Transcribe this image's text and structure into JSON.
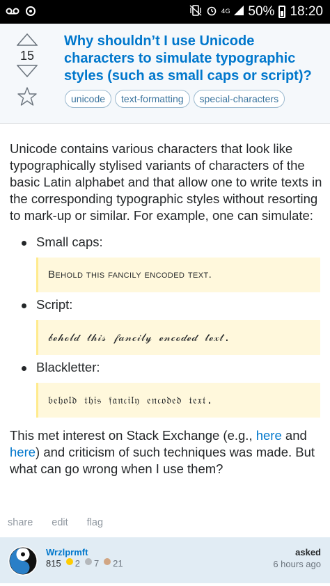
{
  "status_bar": {
    "network": "4G",
    "battery": "50%",
    "time": "18:20",
    "left_icons": [
      "voicemail-icon",
      "sync-icon"
    ],
    "right_icons": [
      "vibrate-icon",
      "alarm-icon",
      "signal-icon",
      "battery-icon"
    ]
  },
  "question": {
    "votes": "15",
    "title": "Why shouldn’t I use Unicode characters to simulate typographic styles (such as small caps or script)?",
    "tags": [
      "unicode",
      "text-formatting",
      "special-characters"
    ]
  },
  "body": {
    "intro": "Unicode contains various characters that look like typographically stylised variants of characters of the basic Latin alphabet and that allow one to write texts in the corresponding typographic styles without resorting to mark-up or similar. For example, one can simulate:",
    "examples": [
      {
        "label": "Small caps:",
        "quote": "Behold this fancily encoded text."
      },
      {
        "label": "Script:",
        "quote": "𝒷ℯ𝒽ℴ𝓁𝒹 𝓉𝒽𝒾𝓈 𝒻𝒶𝓃𝒸𝒾𝓁𝓎 ℯ𝓃𝒸ℴ𝒹ℯ𝒹 𝓉ℯ𝓍𝓉."
      },
      {
        "label": "Blackletter:",
        "quote": "𝔟𝔢𝔥𝔬𝔩𝔡 𝔱𝔥𝔦𝔰 𝔣𝔞𝔫𝔠𝔦𝔩𝔶 𝔢𝔫𝔠𝔬𝔡𝔢𝔡 𝔱𝔢𝔵𝔱."
      }
    ],
    "closing_part1": "This met interest on Stack Exchange (e.g., ",
    "link1": "here",
    "closing_part2": " and ",
    "link2": "here",
    "closing_part3": ") and criticism of such techniques was made. But what can go wrong when I use them?"
  },
  "actions": {
    "share": "share",
    "edit": "edit",
    "flag": "flag"
  },
  "user": {
    "name": "Wrzlprmft",
    "reputation": "815",
    "gold": "2",
    "silver": "7",
    "bronze": "21",
    "asked_label": "asked",
    "asked_time": "6 hours ago",
    "badge_colors": {
      "gold": "#ffcc01",
      "silver": "#b4b8bc",
      "bronze": "#d1a684"
    }
  },
  "colors": {
    "link": "#0077cc",
    "header_bg": "#f5f8fb",
    "user_card_bg": "#e1ecf4"
  }
}
